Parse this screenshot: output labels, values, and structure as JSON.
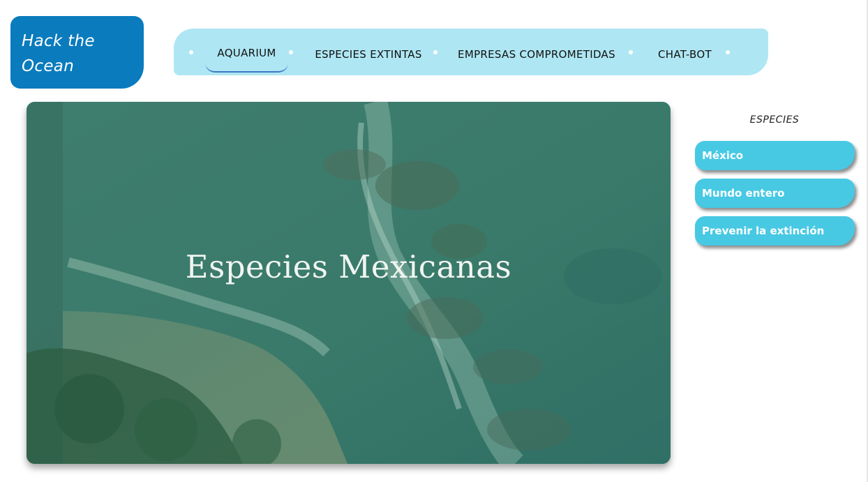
{
  "logo": {
    "line1": "Hack the",
    "line2": "Ocean"
  },
  "nav": {
    "items": [
      {
        "label": "AQUARIUM",
        "active": true
      },
      {
        "label": "ESPECIES EXTINTAS"
      },
      {
        "label": "EMPRESAS COMPROMETIDAS"
      },
      {
        "label": "CHAT-BOT"
      }
    ]
  },
  "hero": {
    "title": "Especies Mexicanas"
  },
  "sidebar": {
    "title": "ESPECIES",
    "buttons": [
      {
        "label": "México"
      },
      {
        "label": "Mundo entero"
      },
      {
        "label": "Prevenir la extinción"
      }
    ]
  },
  "colors": {
    "logo_bg": "#0a7bbd",
    "nav_bg": "#aee7f3",
    "nav_active_underline": "#3f78c6",
    "side_button_bg": "#47c9e4",
    "hero_overlay": "#3e7b6c"
  }
}
